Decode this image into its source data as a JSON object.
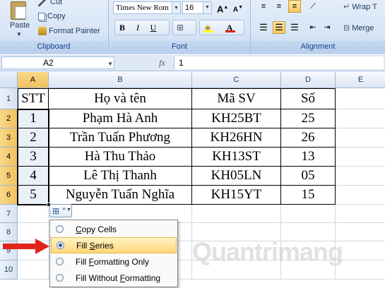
{
  "ribbon": {
    "clipboard": {
      "paste": "Paste",
      "cut": "Cut",
      "copy": "Copy",
      "format_painter": "Format Painter",
      "label": "Clipboard"
    },
    "font": {
      "font_name": "Times New Rom",
      "font_size": "16",
      "grow": "A",
      "shrink": "A",
      "bold": "B",
      "italic": "I",
      "underline": "U",
      "borders": "⊞",
      "fill_color": "◈",
      "font_color": "A",
      "label": "Font"
    },
    "alignment": {
      "wrap": "Wrap T",
      "merge": "Merge",
      "label": "Alignment"
    }
  },
  "formula_bar": {
    "name_box": "A2",
    "fx": "fx",
    "value": "1"
  },
  "columns": [
    "A",
    "B",
    "C",
    "D",
    "E"
  ],
  "rows": [
    "1",
    "2",
    "3",
    "4",
    "5",
    "6",
    "7",
    "8",
    "9",
    "10"
  ],
  "sheet": {
    "header": [
      "STT",
      "Họ và tên",
      "Mã SV",
      "Số"
    ],
    "data": [
      [
        "1",
        "Phạm Hà Anh",
        "KH25BT",
        "25"
      ],
      [
        "2",
        "Trần Tuấn Phương",
        "KH26HN",
        "26"
      ],
      [
        "3",
        "Hà Thu Thảo",
        "KH13ST",
        "13"
      ],
      [
        "4",
        "Lê Thị Thanh",
        "KH05LN",
        "05"
      ],
      [
        "5",
        "Nguyễn Tuấn Nghĩa",
        "KH15YT",
        "15"
      ]
    ]
  },
  "autofill_menu": {
    "items": [
      {
        "pre": "",
        "ul": "C",
        "post": "opy Cells",
        "selected": false
      },
      {
        "pre": "Fill ",
        "ul": "S",
        "post": "eries",
        "selected": true
      },
      {
        "pre": "Fill ",
        "ul": "F",
        "post": "ormatting Only",
        "selected": false
      },
      {
        "pre": "Fill Without ",
        "ul": "F",
        "post": "ormatting",
        "selected": false
      }
    ]
  },
  "watermark": "Quantrimang",
  "colors": {
    "selection_header": "#f1c15f",
    "highlight_item": "#ffd776",
    "arrow": "#e2231a"
  }
}
